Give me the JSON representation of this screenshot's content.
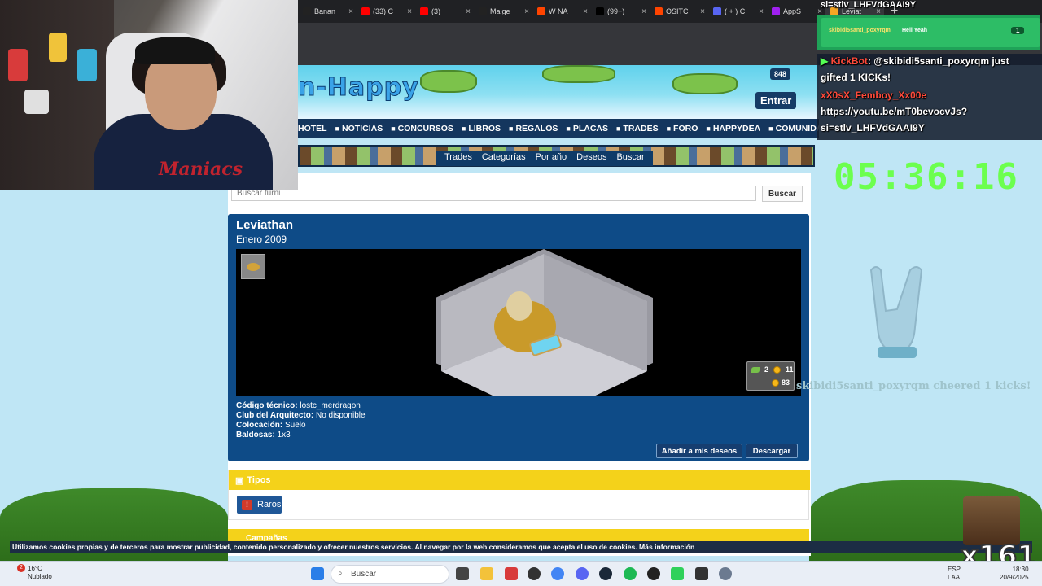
{
  "browser": {
    "tabs": [
      {
        "label": "Banan",
        "color": "#222222"
      },
      {
        "label": "(33) C",
        "color": "#ff0000"
      },
      {
        "label": "(3)",
        "color": "#ff0000"
      },
      {
        "label": "Maige",
        "color": "#222222"
      },
      {
        "label": "W NA",
        "color": "#ff4400"
      },
      {
        "label": "(99+)",
        "color": "#000000"
      },
      {
        "label": "OSITC",
        "color": "#ff4400"
      },
      {
        "label": "( + ) C",
        "color": "#5865f2"
      },
      {
        "label": "AppS",
        "color": "#a020f0"
      },
      {
        "label": "Leviat",
        "color": "#f5a623"
      }
    ]
  },
  "site": {
    "logo_text": "n-Happy",
    "counter": "848",
    "entrar_label": "Entrar",
    "nav": [
      "HOTEL",
      "NOTICIAS",
      "CONCURSOS",
      "LIBROS",
      "REGALOS",
      "PLACAS",
      "TRADES",
      "FORO",
      "HAPPYDEA",
      "COMUNIDAD"
    ],
    "subnav": [
      "Trades",
      "Categorías",
      "Por año",
      "Deseos",
      "Buscar"
    ]
  },
  "search": {
    "placeholder": "Buscar furni",
    "button": "Buscar"
  },
  "furni": {
    "name": "Leviathan",
    "date": "Enero 2009",
    "price_pixels": "2",
    "price_credits": "11",
    "price_total": "83",
    "code_label": "Código técnico:",
    "code_value": "lostc_merdragon",
    "club_label": "Club del Arquitecto:",
    "club_value": "No disponible",
    "placement_label": "Colocación:",
    "placement_value": "Suelo",
    "tiles_label": "Baldosas:",
    "tiles_value": "1x3",
    "wishlist_button": "Añadir a mis deseos",
    "download_button": "Descargar"
  },
  "tipos": {
    "heading": "Tipos",
    "tag": "Raros"
  },
  "campanas": {
    "heading": "Campañas"
  },
  "cookie_text": "Utilizamos cookies propias y de terceros para mostrar publicidad, contenido personalizado y ofrecer nuestros servicios. Al navegar por la web consideramos que acepta el uso de cookies. Más información",
  "overlay": {
    "chat_top": "si=stlv_LHFVdGAAI9Y",
    "alert_user": "skibidi5santi_poxyrqm",
    "alert_text": "Hell Yeah",
    "alert_count": "1",
    "chat": [
      {
        "user": "KickBot",
        "text": ": @skibidi5santi_poxyrqm just"
      },
      {
        "user": "",
        "text": "gifted 1 KICKs!"
      },
      {
        "user": "xX0sX_Femboy_Xx00e",
        "text": ""
      },
      {
        "user": "",
        "text": "https://youtu.be/mT0bevocvJs?"
      },
      {
        "user": "",
        "text": "si=stlv_LHFVdGAAI9Y"
      }
    ],
    "timer": "05:36:16",
    "cheer_text": "skibidi5santi_poxyrqm cheered 1 kicks!",
    "gift_count": "x161",
    "shirt_text": "Maniacs"
  },
  "taskbar": {
    "temp": "16°C",
    "weather": "Nublado",
    "badge": "2",
    "search_placeholder": "Buscar",
    "lang1": "ESP",
    "lang2": "LAA",
    "time": "18:30",
    "date": "20/9/2025"
  }
}
